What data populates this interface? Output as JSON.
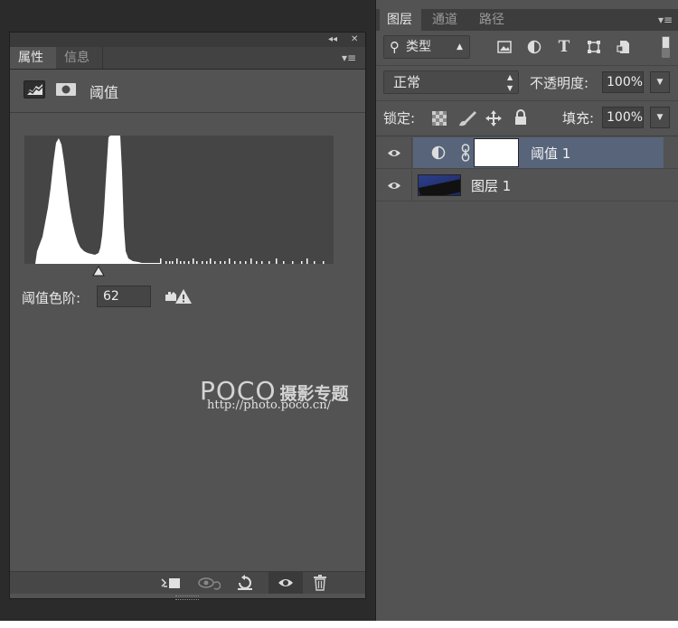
{
  "properties_panel": {
    "titlebar": {
      "collapse_glyph": "◂◂",
      "close_glyph": "✕"
    },
    "tabs": [
      {
        "label": "属性",
        "active": true
      },
      {
        "label": "信息",
        "active": false
      }
    ],
    "menu_glyph": "▾≡",
    "adjustment_name": "阈值",
    "threshold_level_label": "阈值色阶:",
    "threshold_level_value": "62",
    "threshold_level_fraction": 0.24,
    "histogram_icon": "histogram-mountain",
    "watermark": {
      "logo": "POCO",
      "title": "摄影专题",
      "url": "http://photo.poco.cn/"
    },
    "footer_icons": [
      "clip-to-layer-icon",
      "view-previous-icon",
      "reset-icon",
      "visibility-eye-icon",
      "delete-trash-icon"
    ]
  },
  "layers_panel": {
    "tabs": [
      {
        "label": "图层",
        "active": true
      },
      {
        "label": "通道",
        "active": false
      },
      {
        "label": "路径",
        "active": false
      }
    ],
    "menu_glyph": "▾≡",
    "filter": {
      "search_glyph": "⚲",
      "kind_label": "类型",
      "text_filter_glyph": "T"
    },
    "blend_mode": "正常",
    "opacity_label": "不透明度:",
    "opacity_value": "100%",
    "lock_label": "锁定:",
    "fill_label": "填充:",
    "fill_value": "100%",
    "layers": [
      {
        "name": "阈值 1",
        "type": "adjustment",
        "visible": true,
        "selected": true
      },
      {
        "name": "图层 1",
        "type": "image",
        "visible": true,
        "selected": false
      }
    ]
  },
  "colors": {
    "panel": "#535353",
    "selected_row": "#57647a",
    "background": "#2b2b2b"
  }
}
